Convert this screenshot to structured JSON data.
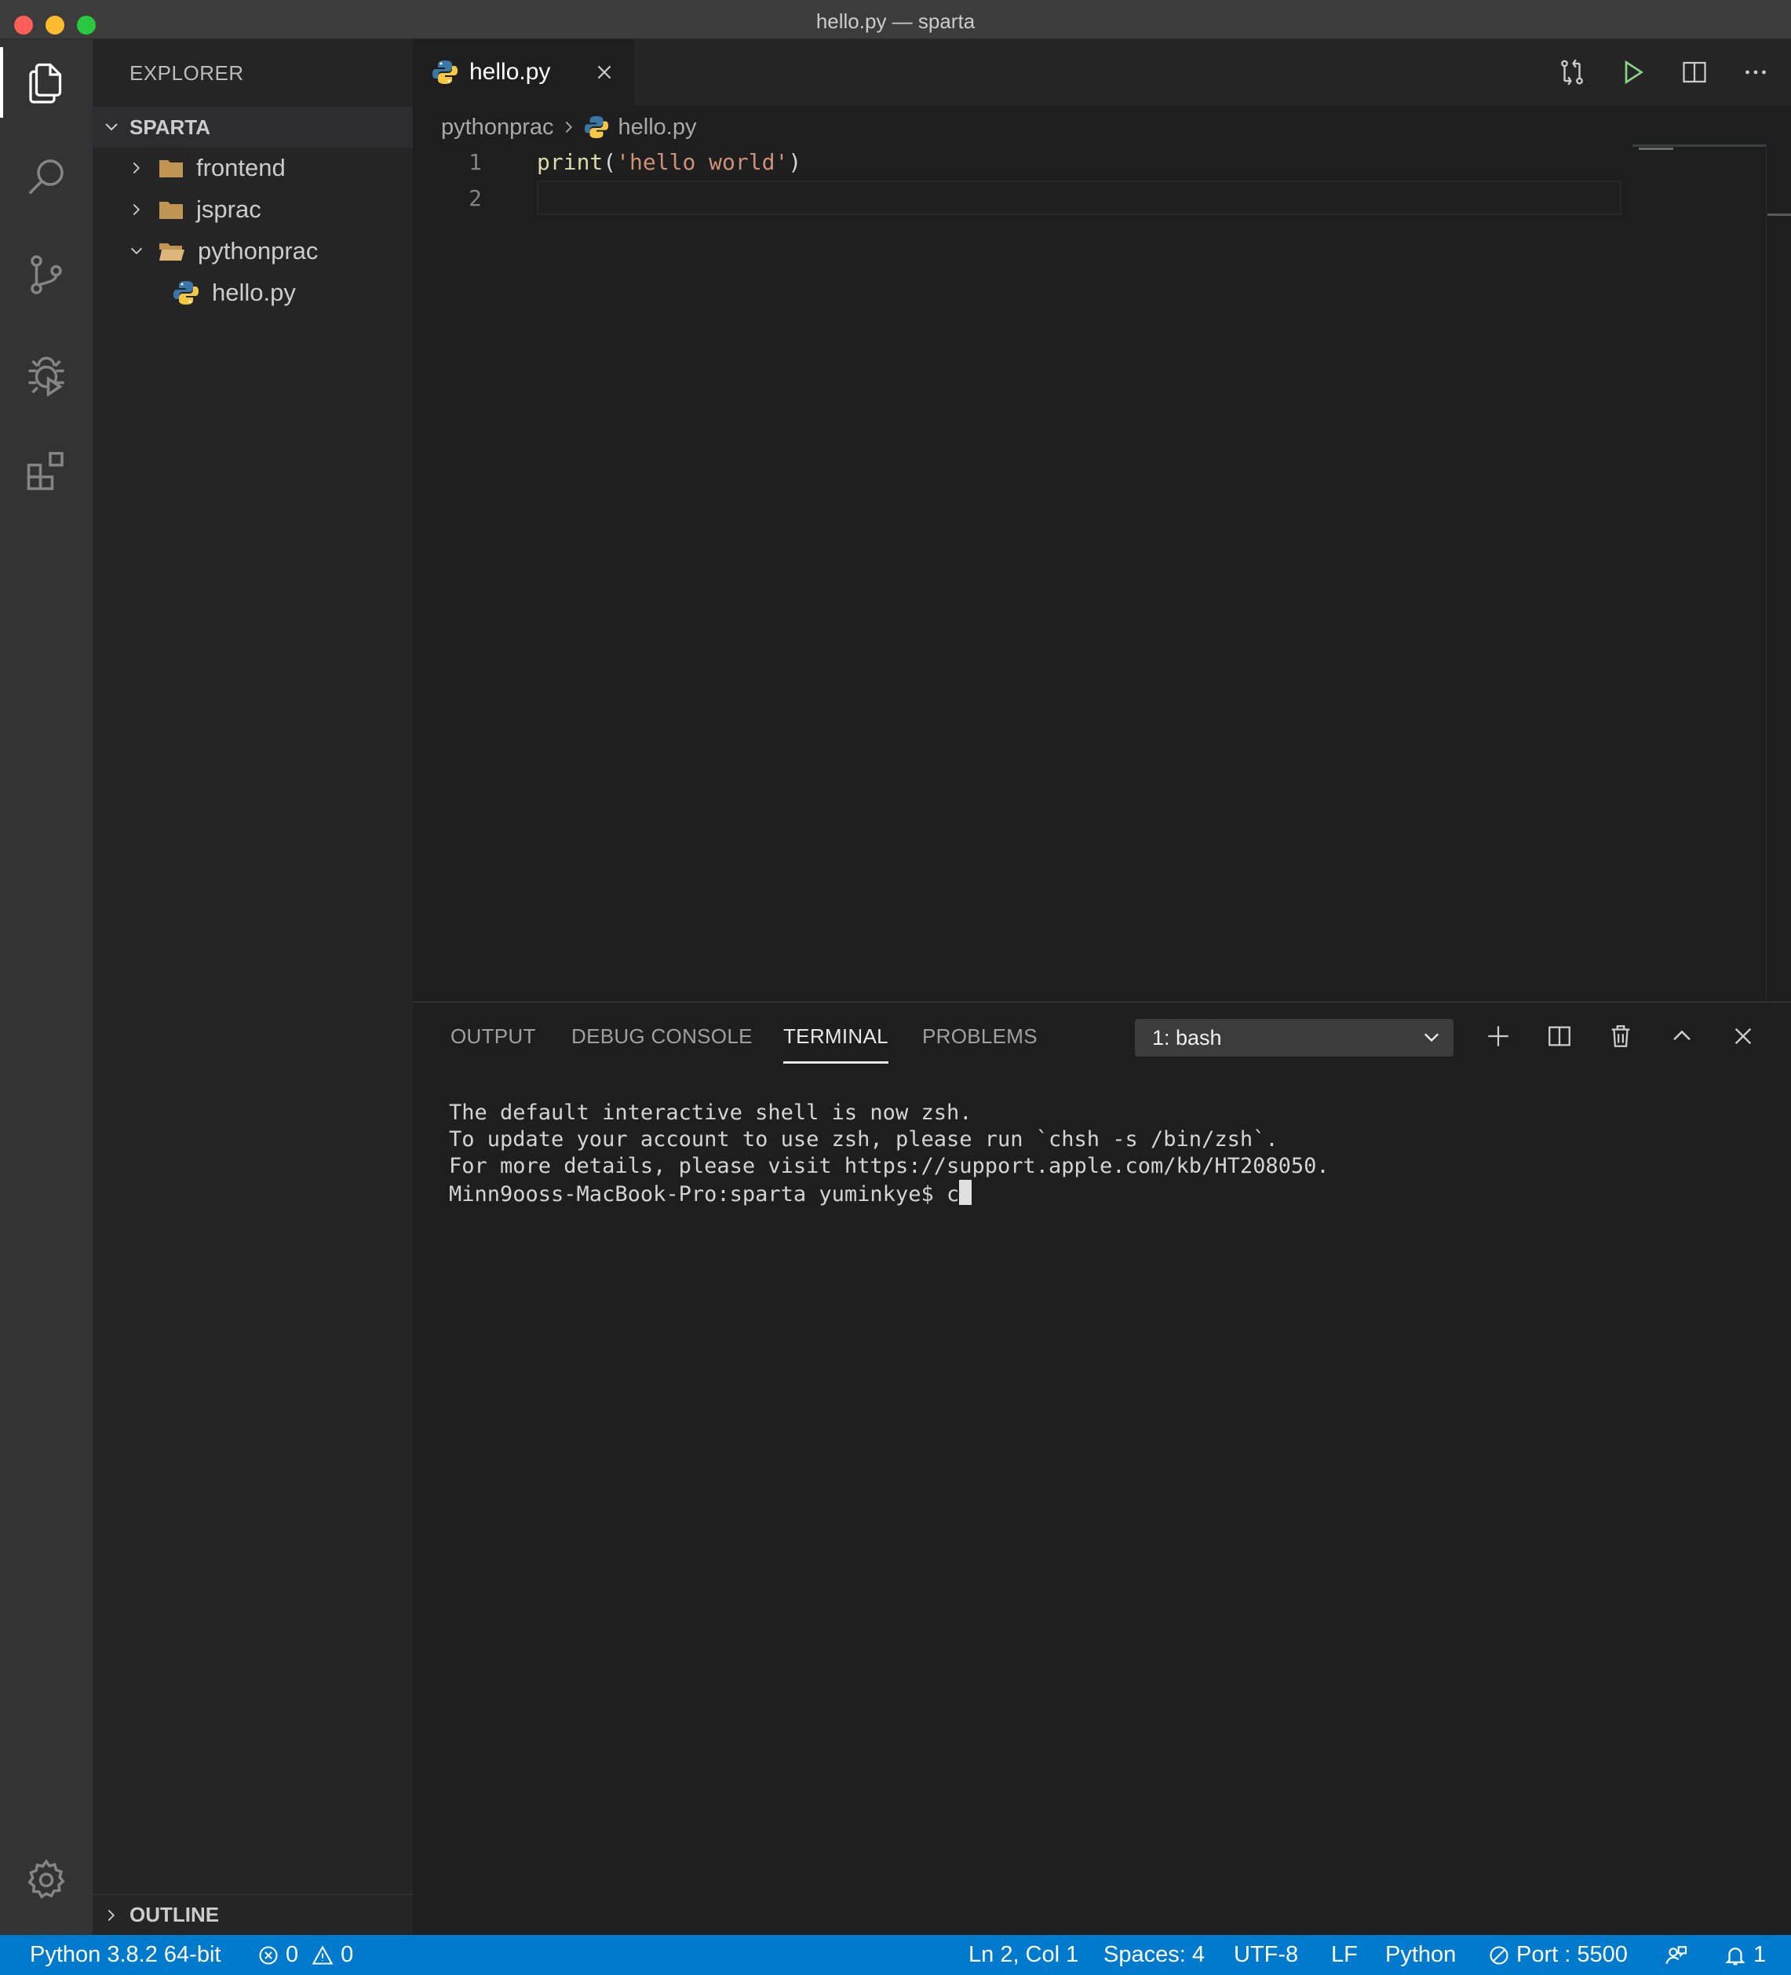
{
  "window": {
    "title": "hello.py — sparta"
  },
  "activity_bar": {
    "items": [
      "files-icon",
      "search-icon",
      "source-control-icon",
      "debug-icon",
      "extensions-icon"
    ],
    "settings_icon": "gear-icon"
  },
  "sidebar": {
    "header": "EXPLORER",
    "section": "SPARTA",
    "tree": [
      {
        "label": "frontend",
        "type": "folder",
        "expanded": false
      },
      {
        "label": "jsprac",
        "type": "folder",
        "expanded": false
      },
      {
        "label": "pythonprac",
        "type": "folder",
        "expanded": true
      },
      {
        "label": "hello.py",
        "type": "python-file"
      }
    ],
    "outline": "OUTLINE"
  },
  "editor": {
    "tab": {
      "label": "hello.py",
      "close_icon": "close-icon"
    },
    "toolbar_icons": [
      "open-changes-icon",
      "run-icon",
      "split-editor-icon",
      "more-icon"
    ],
    "breadcrumb": {
      "folder": "pythonprac",
      "file": "hello.py"
    },
    "lines": [
      {
        "number": "1",
        "fn": "print",
        "open": "(",
        "string": "'hello world'",
        "close": ")"
      },
      {
        "number": "2"
      }
    ]
  },
  "panel": {
    "tabs": [
      "OUTPUT",
      "DEBUG CONSOLE",
      "TERMINAL",
      "PROBLEMS"
    ],
    "active_tab": "TERMINAL",
    "terminal_select": "1: bash",
    "actions": [
      "plus-icon",
      "split-terminal-icon",
      "trash-icon",
      "maximize-chevron-icon",
      "close-icon"
    ],
    "terminal_lines": [
      "The default interactive shell is now zsh.",
      "To update your account to use zsh, please run `chsh -s /bin/zsh`.",
      "For more details, please visit https://support.apple.com/kb/HT208050."
    ],
    "prompt": "Minn9ooss-MacBook-Pro:sparta yuminkye$ ",
    "typed": "c"
  },
  "statusbar": {
    "interpreter": "Python 3.8.2 64-bit",
    "errors": "0",
    "warnings": "0",
    "position": "Ln 2, Col 1",
    "spaces": "Spaces: 4",
    "encoding": "UTF-8",
    "eol": "LF",
    "language": "Python",
    "port": "Port : 5500",
    "notifications": "1"
  },
  "colors": {
    "statusbar": "#007acc",
    "activity_bar": "#333333",
    "sidebar": "#252526",
    "editor": "#1e1e1e",
    "string": "#ce9178",
    "function": "#dcdcaa"
  }
}
